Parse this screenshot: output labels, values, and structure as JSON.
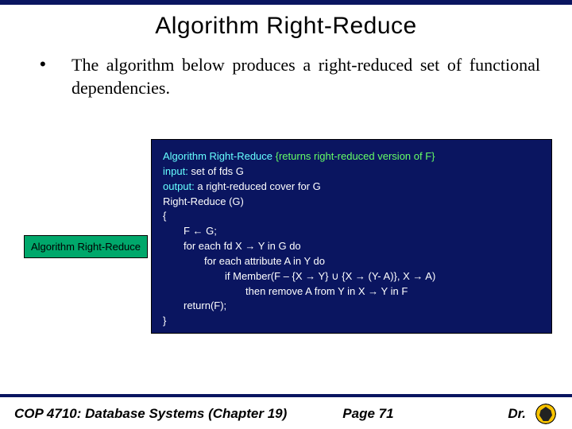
{
  "title": "Algorithm Right-Reduce",
  "intro": "The algorithm below produces a right-reduced set of functional dependencies.",
  "label": "Algorithm Right-Reduce",
  "code": {
    "line1a": "Algorithm Right-Reduce",
    "line1b": "  {returns right-reduced version of F}",
    "line2a": "input:",
    "line2b": "  set of fds G",
    "line3a": "output:",
    "line3b": " a right-reduced cover for G",
    "line4": "Right-Reduce (G)",
    "line5": "{",
    "line6": "F ← G;",
    "line7": "for each fd X → Y in G do",
    "line8": "for each attribute A in Y do",
    "line9": "if Member(F – {X → Y} ∪ {X → (Y- A)}, X → A)",
    "line10": "then remove A from Y in X → Y in F",
    "line11": "return(F);",
    "line12": "}"
  },
  "footer": {
    "left": "COP 4710: Database Systems  (Chapter 19)",
    "page": "Page 71",
    "right": "Dr."
  }
}
